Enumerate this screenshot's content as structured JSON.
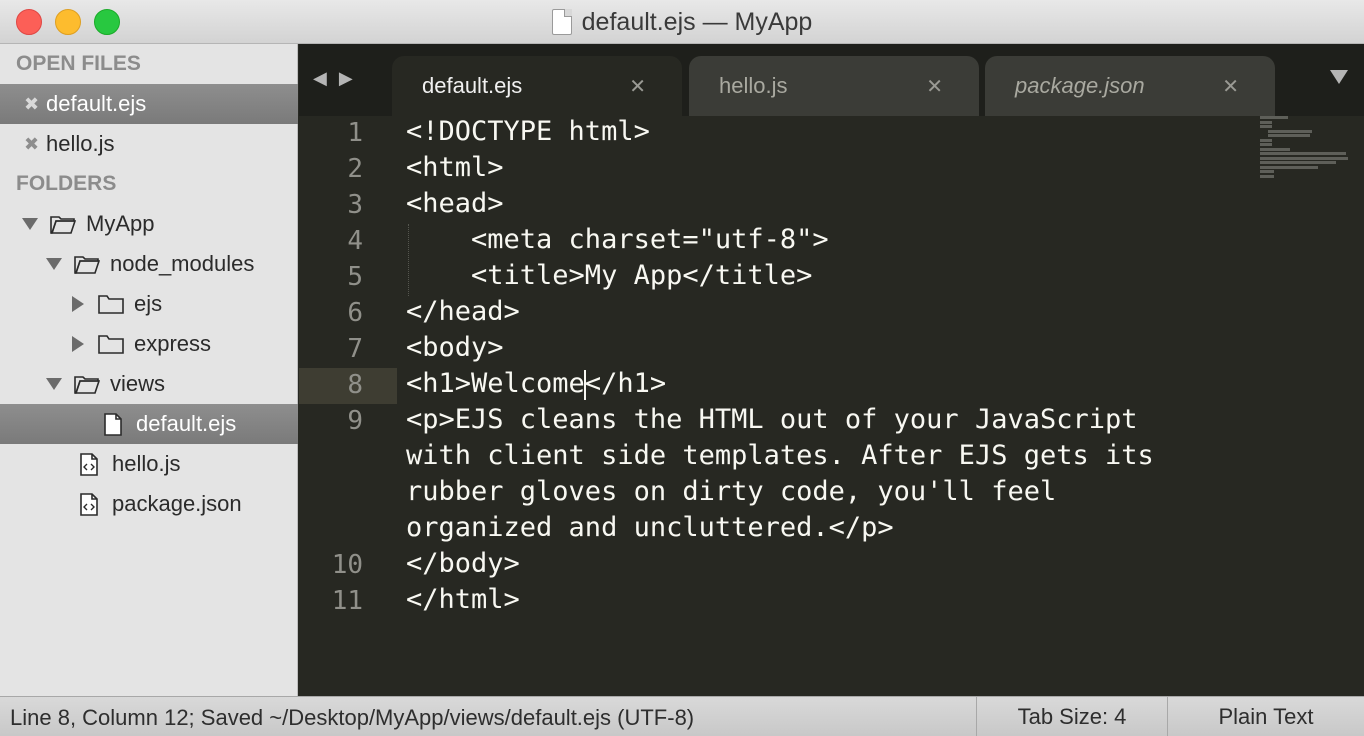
{
  "window": {
    "title": "default.ejs — MyApp"
  },
  "sidebar": {
    "open_files_header": "OPEN FILES",
    "open_files": [
      {
        "name": "default.ejs",
        "selected": true
      },
      {
        "name": "hello.js",
        "selected": false
      }
    ],
    "folders_header": "FOLDERS",
    "tree": [
      {
        "name": "MyApp",
        "type": "folder",
        "expanded": true,
        "depth": 0
      },
      {
        "name": "node_modules",
        "type": "folder",
        "expanded": true,
        "depth": 1
      },
      {
        "name": "ejs",
        "type": "folder",
        "expanded": false,
        "depth": 2
      },
      {
        "name": "express",
        "type": "folder",
        "expanded": false,
        "depth": 2
      },
      {
        "name": "views",
        "type": "folder",
        "expanded": true,
        "depth": 1
      },
      {
        "name": "default.ejs",
        "type": "file",
        "depth": 2,
        "selected": true
      },
      {
        "name": "hello.js",
        "type": "file-code",
        "depth": 1
      },
      {
        "name": "package.json",
        "type": "file-code",
        "depth": 1
      }
    ]
  },
  "tabs": [
    {
      "label": "default.ejs",
      "active": true,
      "italic": false
    },
    {
      "label": "hello.js",
      "active": false,
      "italic": false
    },
    {
      "label": "package.json",
      "active": false,
      "italic": true
    }
  ],
  "tab_close_glyph": "✕",
  "editor": {
    "line_numbers": [
      "1",
      "2",
      "3",
      "4",
      "5",
      "6",
      "7",
      "8",
      "9",
      "10",
      "11"
    ],
    "lines": [
      "<!DOCTYPE html>",
      "<html>",
      "<head>",
      "    <meta charset=\"utf-8\">",
      "    <title>My App</title>",
      "</head>",
      "<body>",
      "<h1>Welcome</h1>",
      "<p>EJS cleans the HTML out of your JavaScript",
      "with client side templates. After EJS gets its",
      "rubber gloves on dirty code, you'll feel",
      "organized and uncluttered.</p>",
      "</body>",
      "</html>"
    ],
    "cursor": {
      "line": 8,
      "column": 12
    }
  },
  "statusbar": {
    "message": "Line 8, Column 12; Saved ~/Desktop/MyApp/views/default.ejs (UTF-8)",
    "tab_size": "Tab Size: 4",
    "syntax": "Plain Text"
  },
  "icons": {
    "nav_back": "◀",
    "nav_forward": "▶",
    "close_open_file": "✖"
  }
}
